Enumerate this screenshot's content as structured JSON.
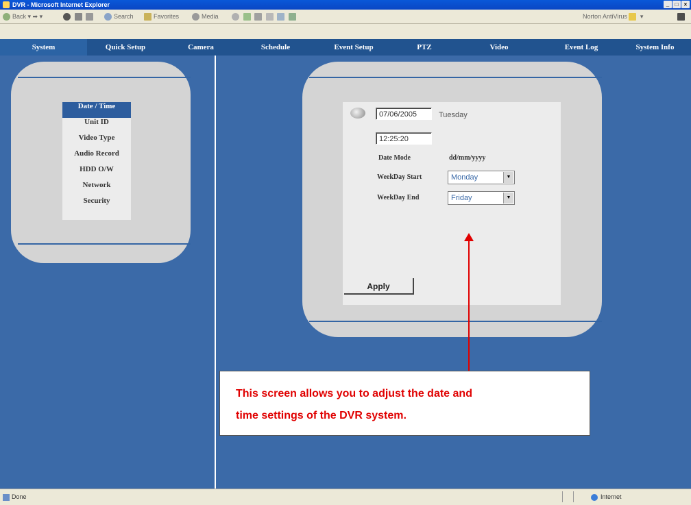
{
  "window": {
    "title": "DVR - Microsoft Internet Explorer",
    "controls": [
      "_",
      "□",
      "×"
    ]
  },
  "toolbar": {
    "back": "Back",
    "search": "Search",
    "favorites": "Favorites",
    "media": "Media",
    "norton": "Norton AntiVirus"
  },
  "nav": {
    "tabs": [
      {
        "label": "System",
        "active": true
      },
      {
        "label": "Quick Setup"
      },
      {
        "label": "Camera"
      },
      {
        "label": "Schedule"
      },
      {
        "label": "Event Setup"
      },
      {
        "label": "PTZ"
      },
      {
        "label": "Video"
      },
      {
        "label": "Event Log"
      },
      {
        "label": "System Info"
      }
    ]
  },
  "sidebar": {
    "items": [
      {
        "label": "Date / Time",
        "active": true
      },
      {
        "label": "Unit ID"
      },
      {
        "label": "Video Type"
      },
      {
        "label": "Audio Record"
      },
      {
        "label": "HDD O/W"
      },
      {
        "label": "Network"
      },
      {
        "label": "Security"
      }
    ]
  },
  "form": {
    "date_value": "07/06/2005",
    "day_of_week": "Tuesday",
    "time_value": "12:25:20",
    "date_mode_label": "Date Mode",
    "date_mode_value": "dd/mm/yyyy",
    "weekday_start_label": "WeekDay Start",
    "weekday_start_value": "Monday",
    "weekday_end_label": "WeekDay End",
    "weekday_end_value": "Friday",
    "apply_label": "Apply"
  },
  "annotation": {
    "line1": "This screen allows you to adjust the date and",
    "line2": "time settings of the DVR system."
  },
  "statusbar": {
    "status": "Done",
    "zone": "Internet"
  },
  "colors": {
    "nav_bg": "#21538f",
    "content_bg": "#3b6aa8",
    "panel_bg": "#d4d4d4",
    "annotation_red": "#e00000"
  }
}
